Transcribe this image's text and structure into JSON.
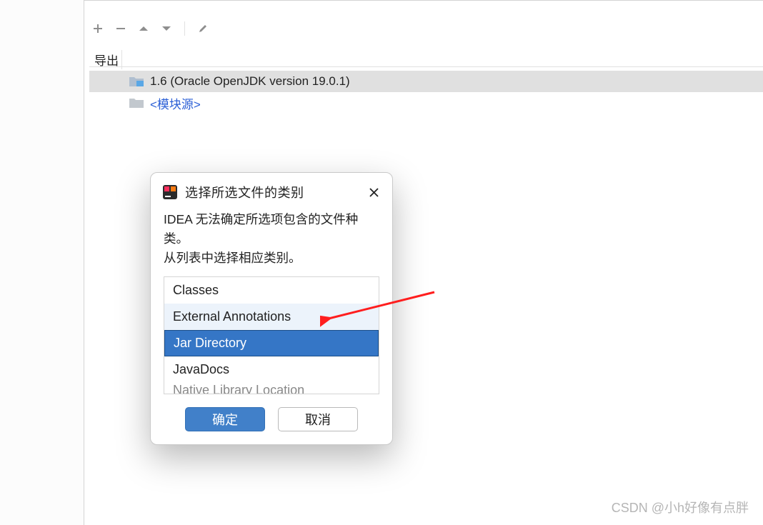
{
  "tab": {
    "label": "导出"
  },
  "tree": {
    "items": [
      {
        "label": "1.6 (Oracle OpenJDK version 19.0.1)"
      },
      {
        "label": "<模块源>"
      }
    ]
  },
  "dialog": {
    "title": "选择所选文件的类别",
    "message_line1": "IDEA 无法确定所选项包含的文件种类。",
    "message_line2": "从列表中选择相应类别。",
    "options": [
      {
        "label": "Classes"
      },
      {
        "label": "External Annotations"
      },
      {
        "label": "Jar Directory"
      },
      {
        "label": "JavaDocs"
      },
      {
        "label": "Native Library Location"
      }
    ],
    "ok": "确定",
    "cancel": "取消"
  },
  "watermark": "CSDN @小h好像有点胖"
}
